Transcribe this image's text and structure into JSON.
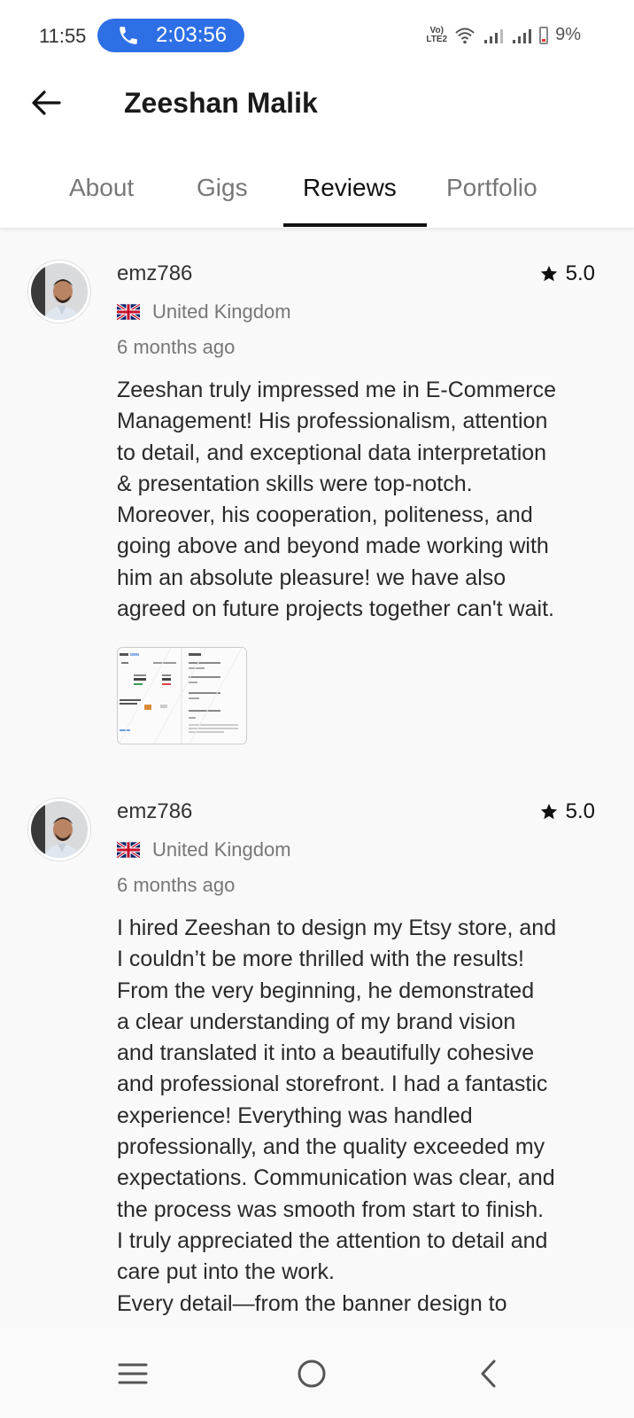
{
  "status_bar": {
    "time": "11:55",
    "call_duration": "2:03:56",
    "volte_label": "Vo)) LTE2",
    "battery": "9%"
  },
  "header": {
    "title": "Zeeshan Malik",
    "back_icon": "arrow-left-icon"
  },
  "tabs": [
    {
      "label": "About",
      "active": false
    },
    {
      "label": "Gigs",
      "active": false
    },
    {
      "label": "Reviews",
      "active": true
    },
    {
      "label": "Portfolio",
      "active": false
    }
  ],
  "reviews": [
    {
      "username": "emz786",
      "rating": "5.0",
      "country": "United Kingdom",
      "time_ago": "6 months ago",
      "text_lines": [
        "Zeeshan truly impressed me in E-Commerce",
        "Management! His professionalism, attention",
        "to detail, and exceptional data interpretation",
        "& presentation skills were top-notch.",
        "Moreover, his cooperation, politeness, and",
        "going above and beyond made working with",
        "him an absolute pleasure! we have also",
        "agreed on future projects together can't wait."
      ],
      "has_attachment": true
    },
    {
      "username": "emz786",
      "rating": "5.0",
      "country": "United Kingdom",
      "time_ago": "6 months ago",
      "text_lines": [
        "I hired Zeeshan to design my Etsy store, and",
        "I couldn’t be more thrilled with the results!",
        "From the very beginning, he demonstrated",
        "a clear understanding of my brand vision",
        "and translated it into a beautifully cohesive",
        "and professional storefront. I had a fantastic",
        "experience! Everything was handled",
        "professionally, and the quality exceeded my",
        "expectations. Communication was clear, and",
        "the process was smooth from start to finish.",
        "I truly appreciated the attention to detail and",
        "care put into the work.",
        "Every detail—from the banner design to"
      ],
      "has_attachment": false
    }
  ],
  "nav_bar": {
    "icons": [
      "recent-apps-icon",
      "home-icon",
      "back-icon"
    ]
  }
}
